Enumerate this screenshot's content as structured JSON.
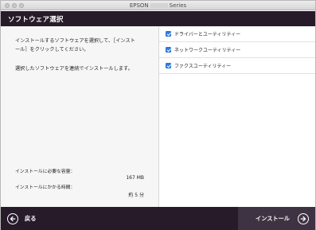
{
  "window": {
    "title_prefix": "EPSON",
    "title_suffix": "Series"
  },
  "header": {
    "title": "ソフトウェア選択"
  },
  "left": {
    "desc_line1": "インストールするソフトウェアを選択して、［インスト",
    "desc_line2": "ール］をクリックしてください。",
    "note": "選択したソフトウェアを連続でインストールします。",
    "required_space_label": "インストールに必要な容量：",
    "required_space_value": "167 MB",
    "install_time_label": "インストールにかかる時間：",
    "install_time_value": "約 5 分"
  },
  "software_list": [
    {
      "label": "ドライバーとユーティリティー",
      "checked": true
    },
    {
      "label": "ネットワークユーティリティー",
      "checked": true
    },
    {
      "label": "ファクスユーティリティー",
      "checked": true
    }
  ],
  "footer": {
    "back_label": "戻る",
    "install_label": "インストール"
  },
  "colors": {
    "header_bg": "#271b2a",
    "install_bg": "#3e3342",
    "checkbox": "#2f7fe3"
  }
}
